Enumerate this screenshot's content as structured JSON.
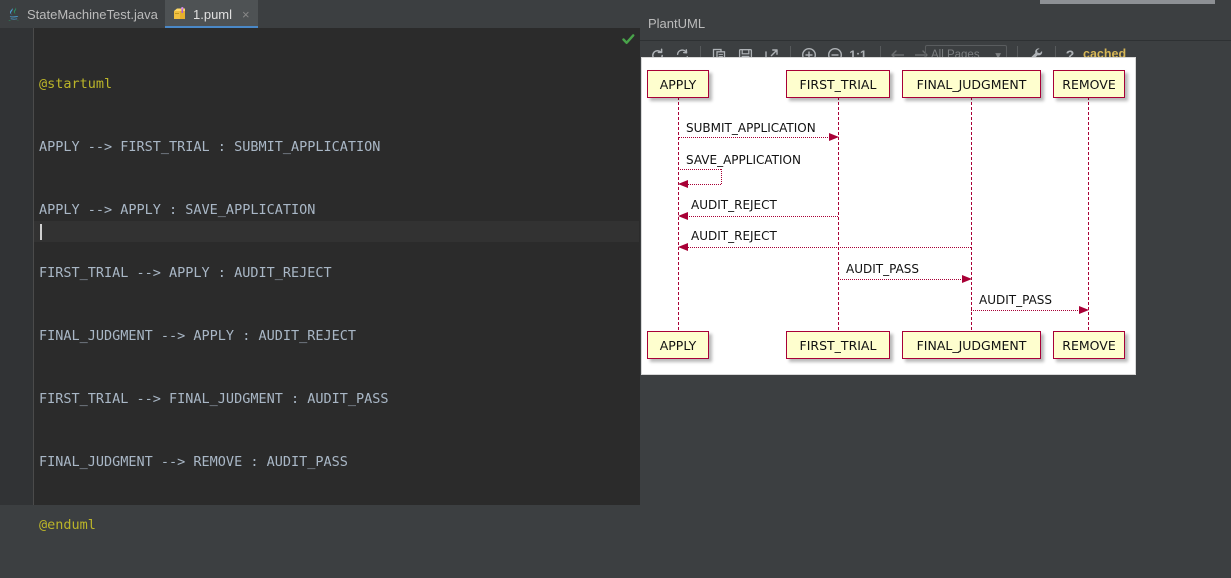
{
  "window": {
    "editor_tabs": [
      {
        "label": "StateMachineTest.java",
        "icon": "java-file-icon",
        "close": "×",
        "active": false
      },
      {
        "label": "1.puml",
        "icon": "puml-file-icon",
        "close": "×",
        "active": true
      }
    ],
    "inspection_status_icon": "green-checkmark-icon"
  },
  "editor": {
    "lines": [
      {
        "text": "@startuml",
        "type": "annotation"
      },
      {
        "text": "APPLY --> FIRST_TRIAL : SUBMIT_APPLICATION",
        "type": "code"
      },
      {
        "text": "APPLY --> APPLY : SAVE_APPLICATION",
        "type": "code"
      },
      {
        "text": "FIRST_TRIAL --> APPLY : AUDIT_REJECT",
        "type": "code"
      },
      {
        "text": "FINAL_JUDGMENT --> APPLY : AUDIT_REJECT",
        "type": "code"
      },
      {
        "text": "FIRST_TRIAL --> FINAL_JUDGMENT : AUDIT_PASS",
        "type": "code"
      },
      {
        "text": "FINAL_JUDGMENT --> REMOVE : AUDIT_PASS",
        "type": "code"
      },
      {
        "text": "@enduml",
        "type": "annotation"
      },
      {
        "text": "",
        "type": "code"
      }
    ],
    "colors": {
      "annotation": "#bbb529",
      "code": "#a9b7c6",
      "background": "#2b2b2b",
      "current_line": "#323232"
    }
  },
  "uml_panel": {
    "title": "PlantUML",
    "toolbar": [
      {
        "name": "refresh-icon",
        "label": "",
        "interactable": true
      },
      {
        "name": "reload-sync-icon",
        "label": "",
        "interactable": true
      },
      {
        "name": "copy-icon",
        "label": "",
        "interactable": true
      },
      {
        "name": "save-icon",
        "label": "",
        "interactable": true
      },
      {
        "name": "open-external-icon",
        "label": "",
        "interactable": true
      },
      {
        "name": "zoom-in-icon",
        "label": "",
        "interactable": true
      },
      {
        "name": "zoom-out-icon",
        "label": "",
        "interactable": true
      },
      {
        "name": "zoom-actual-size-button",
        "label": "1:1",
        "interactable": true
      },
      {
        "name": "previous-page-icon",
        "label": "",
        "interactable": true
      },
      {
        "name": "next-page-icon",
        "label": "",
        "interactable": true
      }
    ],
    "pages_select": {
      "value": "All Pages",
      "chevron": "▾"
    },
    "settings_icon": "wrench-icon",
    "help_label": "?",
    "status_label": "cached",
    "status_color": "#d6b656"
  },
  "diagram": {
    "type": "sequence",
    "participants": [
      "APPLY",
      "FIRST_TRIAL",
      "FINAL_JUDGMENT",
      "REMOVE"
    ],
    "messages": [
      {
        "label": "SUBMIT_APPLICATION",
        "from": "APPLY",
        "to": "FIRST_TRIAL",
        "direction": "right"
      },
      {
        "label": "SAVE_APPLICATION",
        "from": "APPLY",
        "to": "APPLY",
        "direction": "self"
      },
      {
        "label": "AUDIT_REJECT",
        "from": "FIRST_TRIAL",
        "to": "APPLY",
        "direction": "left"
      },
      {
        "label": "AUDIT_REJECT",
        "from": "FINAL_JUDGMENT",
        "to": "APPLY",
        "direction": "left"
      },
      {
        "label": "AUDIT_PASS",
        "from": "FIRST_TRIAL",
        "to": "FINAL_JUDGMENT",
        "direction": "right"
      },
      {
        "label": "AUDIT_PASS",
        "from": "FINAL_JUDGMENT",
        "to": "REMOVE",
        "direction": "right"
      }
    ],
    "colors": {
      "box_fill": "#fefece",
      "box_border": "#a80036",
      "line": "#a80036",
      "canvas": "#ffffff"
    }
  }
}
